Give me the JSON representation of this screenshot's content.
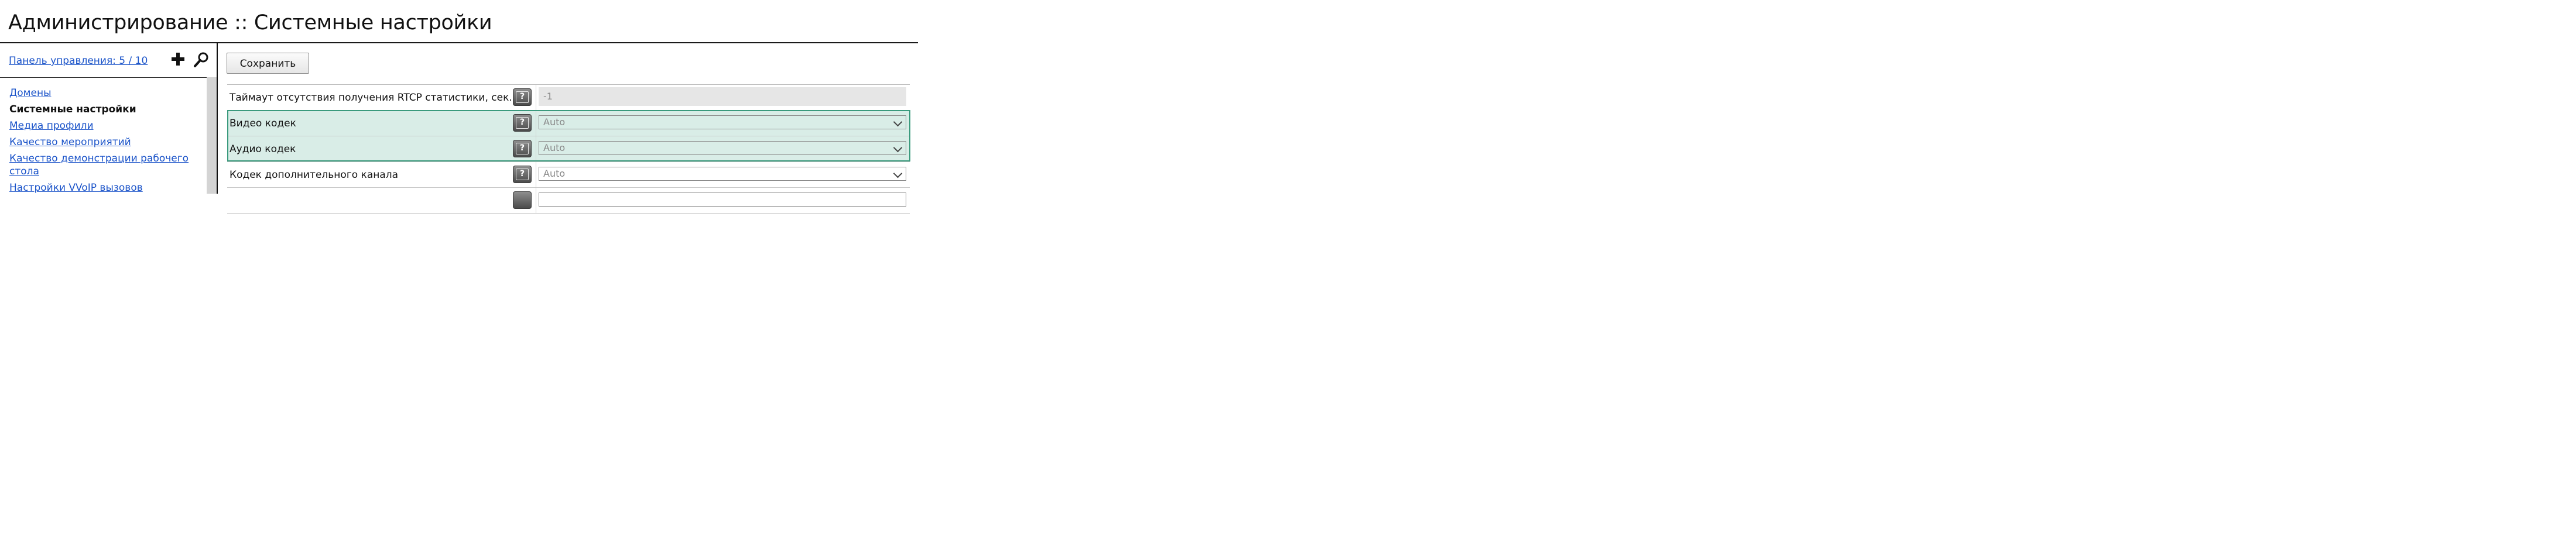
{
  "header": {
    "title": "Администрирование :: Системные настройки"
  },
  "sidebar": {
    "panel_link": "Панель управления: 5 / 10",
    "items": [
      {
        "label": "Домены",
        "active": false
      },
      {
        "label": "Системные настройки",
        "active": true
      },
      {
        "label": "Медиа профили",
        "active": false
      },
      {
        "label": "Качество мероприятий",
        "active": false
      },
      {
        "label": "Качество демонстрации рабочего стола",
        "active": false
      },
      {
        "label": "Настройки VVoIP вызовов",
        "active": false
      }
    ],
    "icons": [
      "plus-icon",
      "search-icon"
    ]
  },
  "toolbar": {
    "save_label": "Сохранить"
  },
  "settings": {
    "help_glyph": "?",
    "rows": [
      {
        "label": "Таймаут отсутствия получения RTCP статистики, сек.",
        "value": "-1",
        "type": "readonly"
      },
      {
        "label": "Видео кодек",
        "value": "Auto",
        "type": "select"
      },
      {
        "label": "Аудио кодек",
        "value": "Auto",
        "type": "select"
      },
      {
        "label": "Кодек дополнительного канала",
        "value": "Auto",
        "type": "select"
      }
    ]
  },
  "colors": {
    "link": "#1a53c9",
    "highlight_bg": "#d9ede7",
    "highlight_border": "#3a9a7d"
  }
}
